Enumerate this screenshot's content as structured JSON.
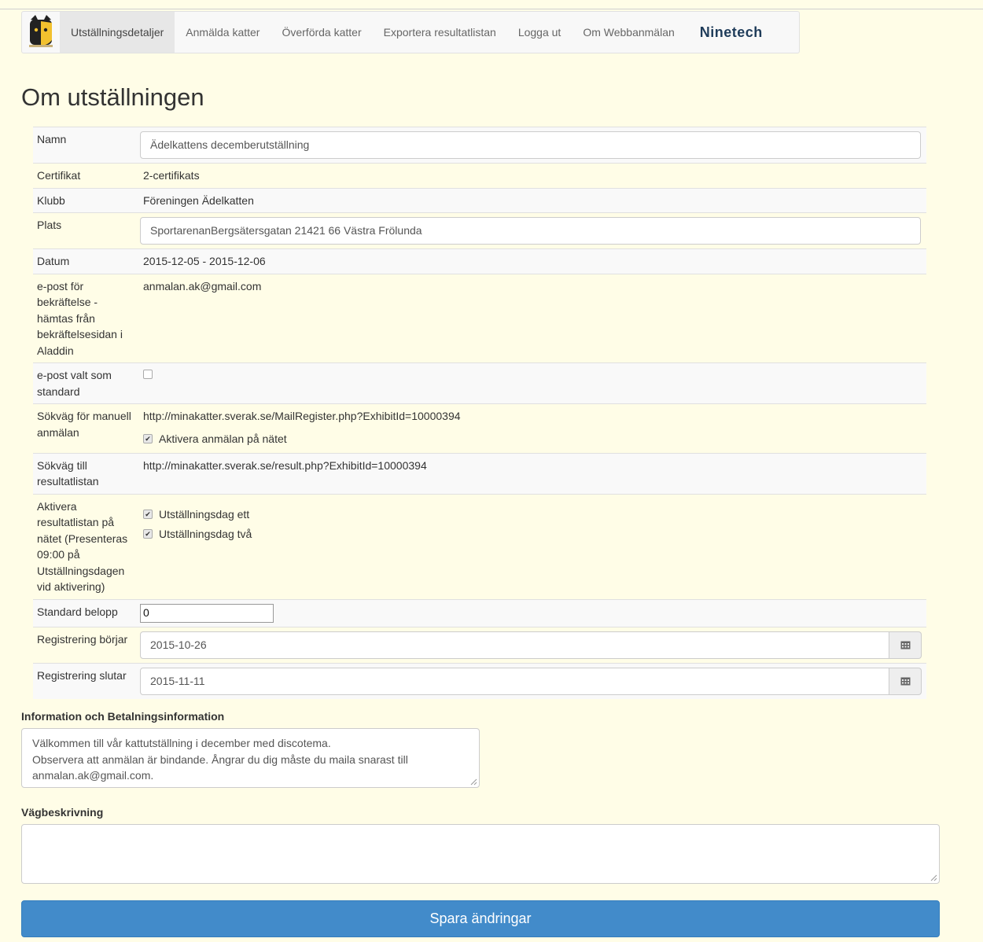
{
  "nav": {
    "items": [
      "Utställningsdetaljer",
      "Anmälda katter",
      "Överförda katter",
      "Exportera resultatlistan",
      "Logga ut",
      "Om Webbanmälan"
    ],
    "brand": "Ninetech"
  },
  "page_title": "Om utställningen",
  "fields": {
    "namn_label": "Namn",
    "namn_value": "Ädelkattens decemberutställning",
    "certifikat_label": "Certifikat",
    "certifikat_value": "2-certifikats",
    "klubb_label": "Klubb",
    "klubb_value": "Föreningen Ädelkatten",
    "plats_label": "Plats",
    "plats_value": "SportarenanBergsätersgatan 21421 66 Västra Frölunda",
    "datum_label": "Datum",
    "datum_value": "2015-12-05 - 2015-12-06",
    "epost_label": "e-post för bekräftelse - hämtas från bekräftelsesidan i Aladdin",
    "epost_value": "anmalan.ak@gmail.com",
    "epost_standard_label": "e-post valt som standard",
    "manuell_label": "Sökväg för manuell anmälan",
    "manuell_value": "http://minakatter.sverak.se/MailRegister.php?ExhibitId=10000394",
    "aktivera_natet_label": "Aktivera anmälan på nätet",
    "resultat_label": "Sökväg till resultatlistan",
    "resultat_value": "http://minakatter.sverak.se/result.php?ExhibitId=10000394",
    "aktivera_resultat_label": "Aktivera resultatlistan på nätet (Presenteras 09:00 på Utställningsdagen vid aktivering)",
    "dag_ett_label": "Utställningsdag ett",
    "dag_tva_label": "Utställningsdag två",
    "belopp_label": "Standard belopp",
    "belopp_value": "0",
    "reg_borjar_label": "Registrering börjar",
    "reg_borjar_value": "2015-10-26",
    "reg_slutar_label": "Registrering slutar",
    "reg_slutar_value": "2015-11-11"
  },
  "checks": {
    "epost_standard": false,
    "aktivera_natet": true,
    "dag_ett": true,
    "dag_tva": true
  },
  "info": {
    "label": "Information och Betalningsinformation",
    "line1": "Välkommen till vår kattutställning i december med discotema.",
    "line2": "Observera att anmälan är bindande. Ångrar du dig måste du maila snarast till",
    "line3": "anmalan.ak@gmail.com."
  },
  "vagbeskrivning": {
    "label": "Vägbeskrivning",
    "value": ""
  },
  "save_label": "Spara ändringar",
  "icons": {
    "logo": "cat-logo-icon",
    "calendar": "calendar-icon"
  }
}
